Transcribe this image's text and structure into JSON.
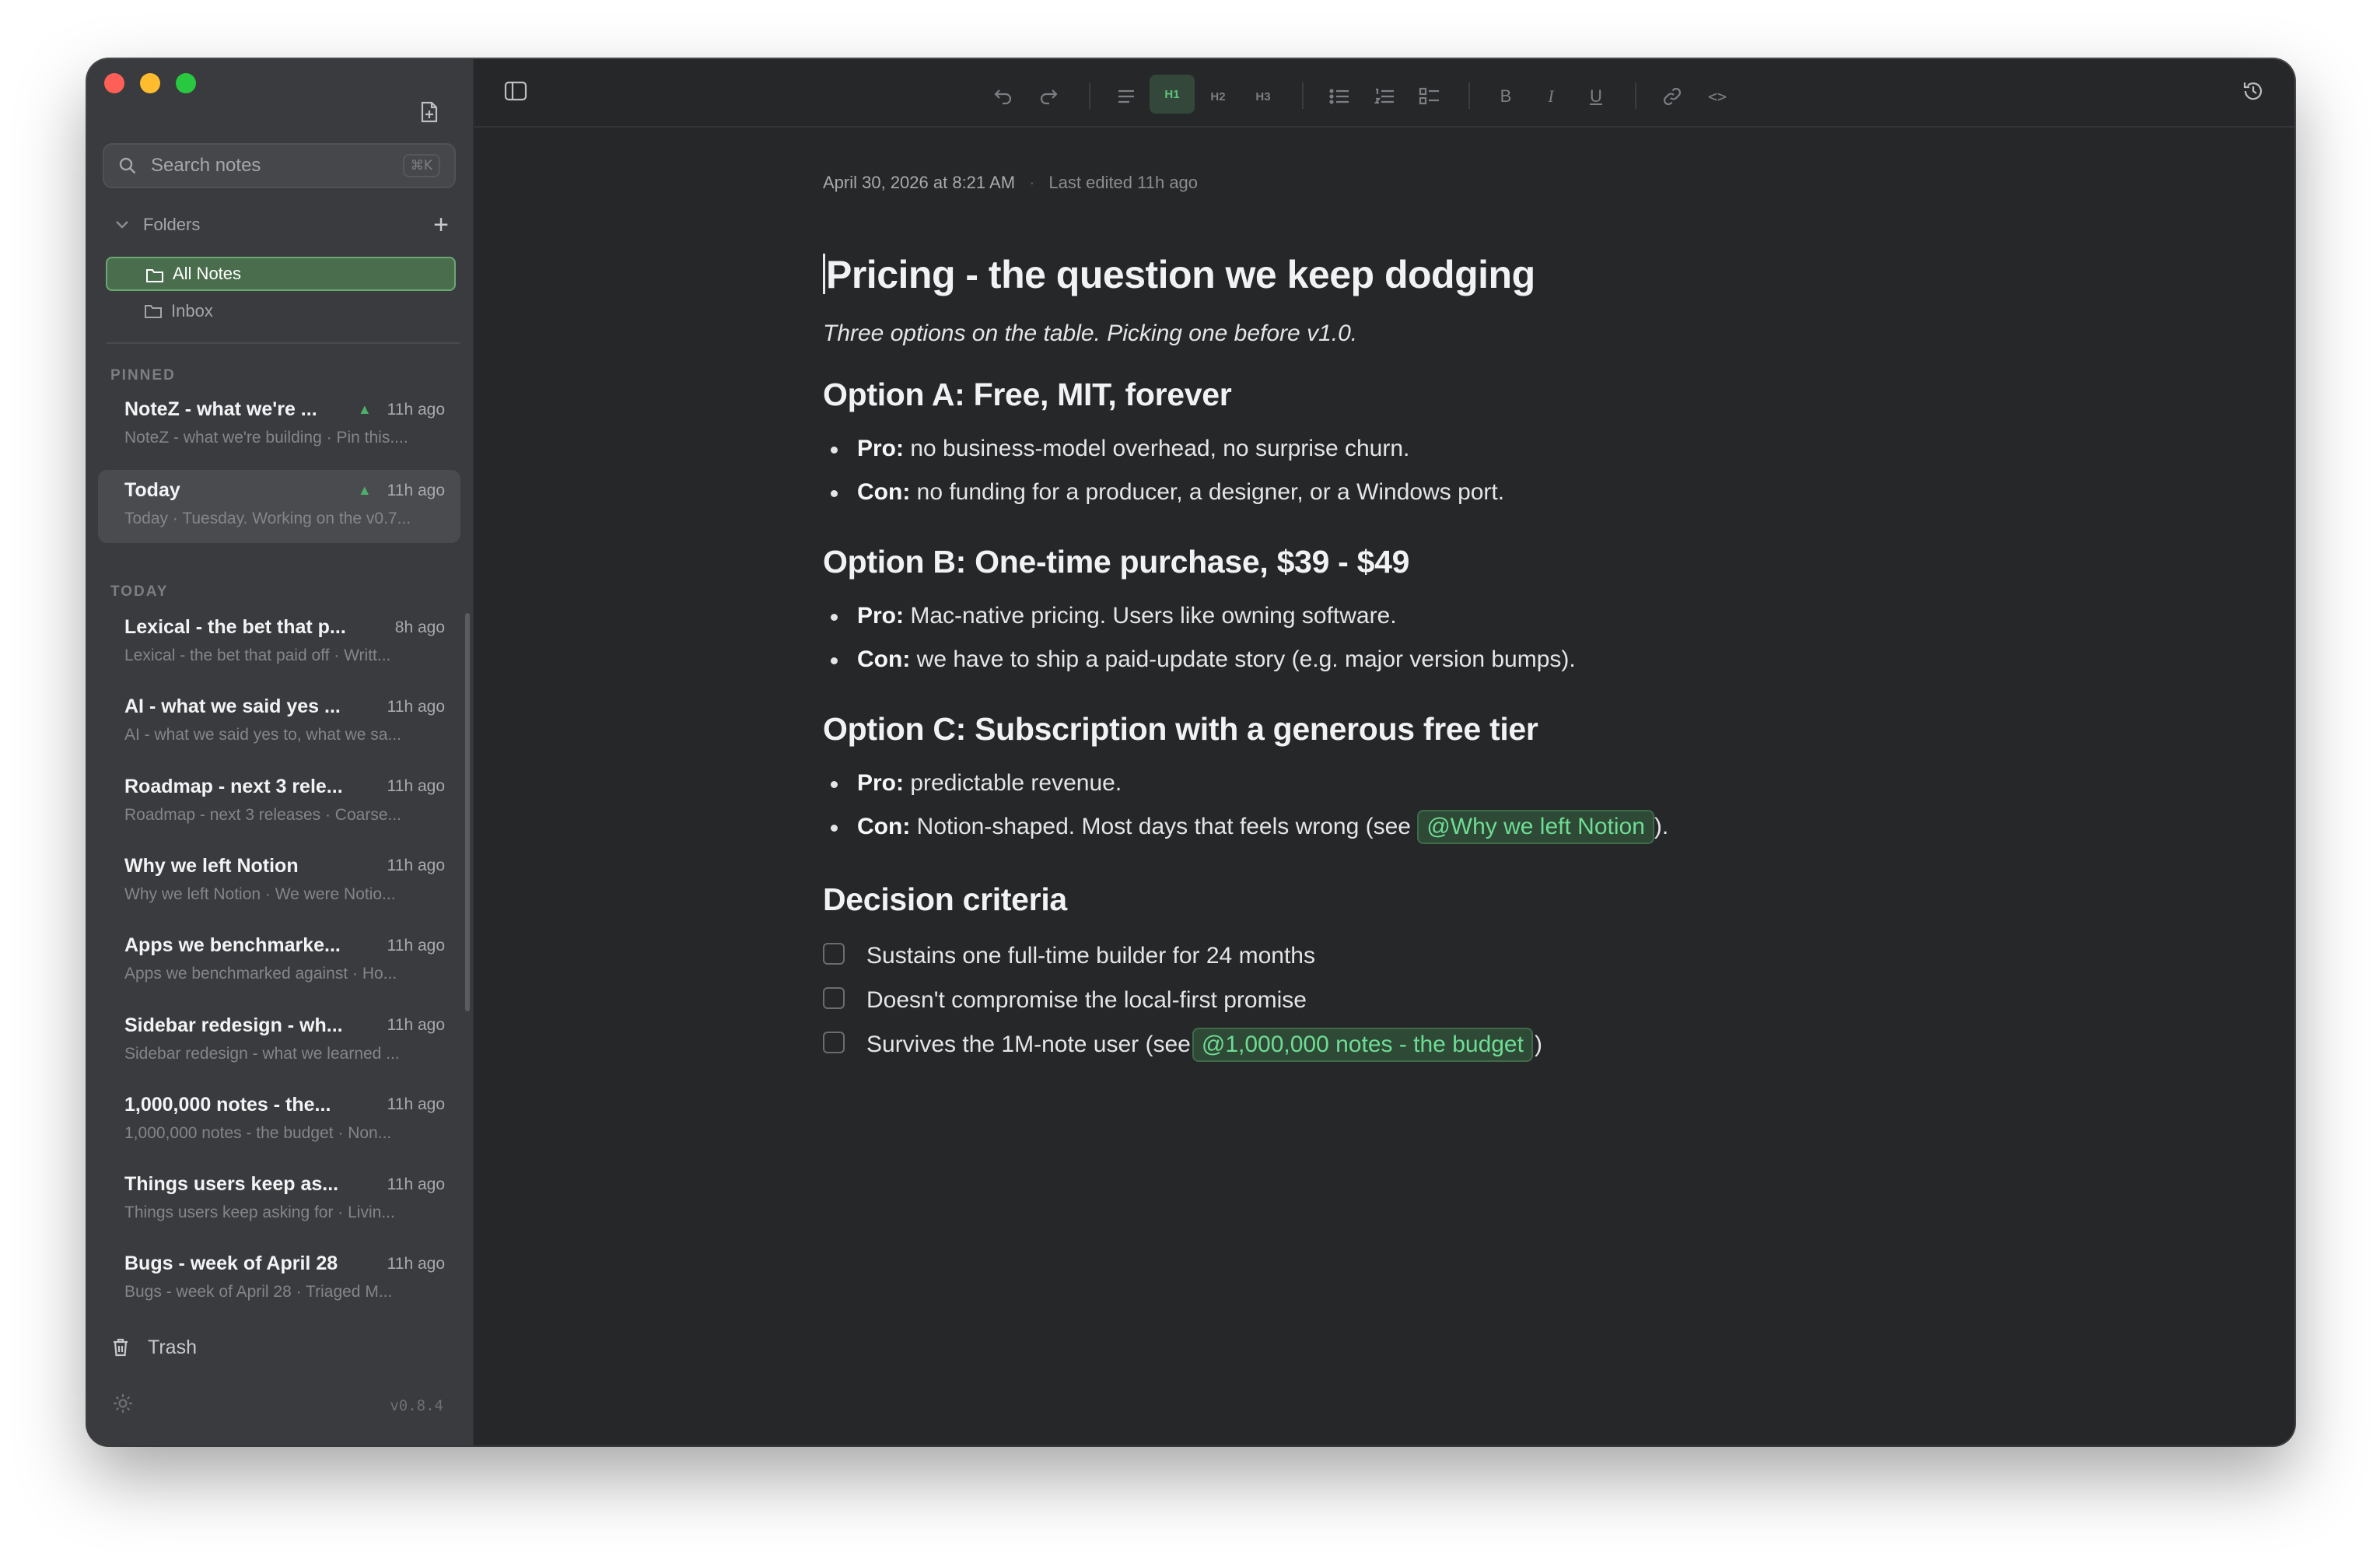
{
  "sidebar": {
    "search_placeholder": "Search notes",
    "search_shortcut": "⌘K",
    "folders_label": "Folders",
    "add_folder_label": "+",
    "folders": [
      {
        "label": "All Notes",
        "active": true
      },
      {
        "label": "Inbox",
        "active": false
      }
    ],
    "pinned_label": "PINNED",
    "pinned": [
      {
        "title": "NoteZ - what we're ...",
        "time": "11h ago",
        "preview": "NoteZ - what we're building · Pin this....",
        "pinned": true
      },
      {
        "title": "Today",
        "time": "11h ago",
        "preview": "Today · Tuesday. Working on the v0.7...",
        "pinned": true
      }
    ],
    "today_label": "TODAY",
    "today": [
      {
        "title": "Lexical - the bet that p...",
        "time": "8h ago",
        "preview": "Lexical - the bet that paid off · Writt..."
      },
      {
        "title": "AI - what we said yes ...",
        "time": "11h ago",
        "preview": "AI - what we said yes to, what we sa..."
      },
      {
        "title": "Roadmap - next 3 rele...",
        "time": "11h ago",
        "preview": "Roadmap - next 3 releases · Coarse..."
      },
      {
        "title": "Why we left Notion",
        "time": "11h ago",
        "preview": "Why we left Notion · We were Notio..."
      },
      {
        "title": "Apps we benchmarke...",
        "time": "11h ago",
        "preview": "Apps we benchmarked against · Ho..."
      },
      {
        "title": "Sidebar redesign - wh...",
        "time": "11h ago",
        "preview": "Sidebar redesign - what we learned ..."
      },
      {
        "title": "1,000,000 notes - the...",
        "time": "11h ago",
        "preview": "1,000,000 notes - the budget · Non..."
      },
      {
        "title": "Things users keep as...",
        "time": "11h ago",
        "preview": "Things users keep asking for · Livin..."
      },
      {
        "title": "Bugs - week of April 28",
        "time": "11h ago",
        "preview": "Bugs - week of April 28 · Triaged M..."
      }
    ],
    "trash_label": "Trash",
    "version": "v0.8.4"
  },
  "toolbar": {
    "active_heading": "H1",
    "h1": "H1",
    "h2": "H2",
    "h3": "H3",
    "bold": "B",
    "italic": "I",
    "underline": "U",
    "code": "<>"
  },
  "doc": {
    "created": "April 30, 2026 at 8:21 AM",
    "separator": "·",
    "edited": "Last edited 11h ago",
    "title": "Pricing - the question we keep dodging",
    "subtitle": "Three options on the table. Picking one before v1.0.",
    "sections": [
      {
        "heading": "Option A: Free, MIT, forever",
        "items": [
          {
            "label": "Pro:",
            "text": " no business-model overhead, no surprise churn."
          },
          {
            "label": "Con:",
            "text": " no funding for a producer, a designer, or a Windows port."
          }
        ]
      },
      {
        "heading": "Option B: One-time purchase, $39 - $49",
        "items": [
          {
            "label": "Pro:",
            "text": " Mac-native pricing. Users like owning software."
          },
          {
            "label": "Con:",
            "text": " we have to ship a paid-update story (e.g. major version bumps)."
          }
        ]
      },
      {
        "heading": "Option C: Subscription with a generous free tier",
        "items": [
          {
            "label": "Pro:",
            "text": " predictable revenue."
          },
          {
            "label": "Con:",
            "text": " Notion-shaped. Most days that feels wrong (see ",
            "mention": "@Why we left Notion",
            "after": ")."
          }
        ]
      }
    ],
    "criteria_heading": "Decision criteria",
    "criteria": [
      {
        "text": "Sustains one full-time builder for 24 months",
        "checked": false
      },
      {
        "text": "Doesn't compromise the local-first promise",
        "checked": false
      },
      {
        "text": "Survives the 1M-note user (see ",
        "mention": "@1,000,000 notes - the budget",
        "after": ")",
        "checked": false
      }
    ]
  },
  "colors": {
    "accent": "#5ec27a",
    "mention_text": "#6fdc94",
    "active_folder_bg": "#4a6e4d"
  }
}
